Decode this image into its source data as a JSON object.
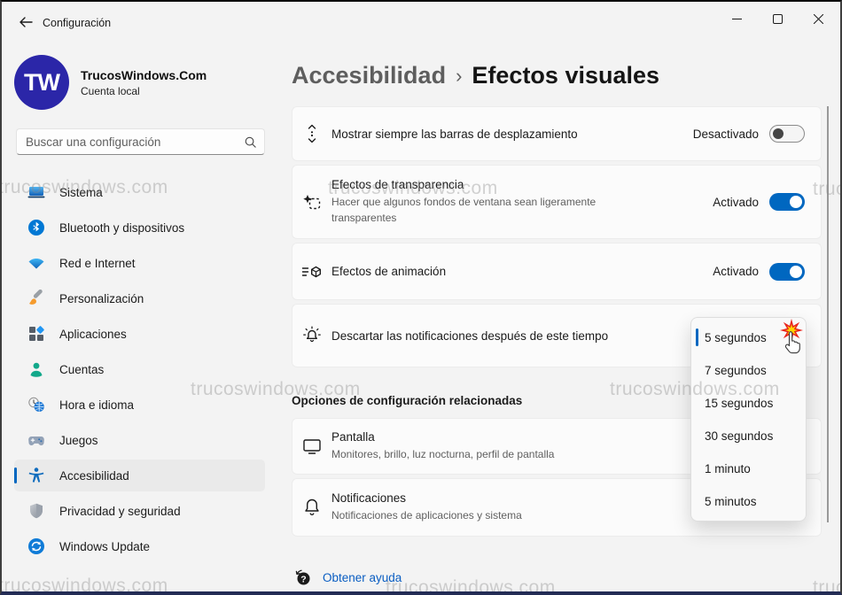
{
  "titlebar": {
    "title": "Configuración"
  },
  "watermark": "trucoswindows.com",
  "profile": {
    "initials": "TW",
    "name": "TrucosWindows.Com",
    "account_type": "Cuenta local"
  },
  "search": {
    "placeholder": "Buscar una configuración"
  },
  "sidebar": {
    "items": [
      {
        "label": "Sistema"
      },
      {
        "label": "Bluetooth y dispositivos"
      },
      {
        "label": "Red e Internet"
      },
      {
        "label": "Personalización"
      },
      {
        "label": "Aplicaciones"
      },
      {
        "label": "Cuentas"
      },
      {
        "label": "Hora e idioma"
      },
      {
        "label": "Juegos"
      },
      {
        "label": "Accesibilidad",
        "selected": true
      },
      {
        "label": "Privacidad y seguridad"
      },
      {
        "label": "Windows Update"
      }
    ]
  },
  "header": {
    "breadcrumb": "Accesibilidad",
    "separator": "›",
    "title": "Efectos visuales"
  },
  "settings": [
    {
      "title": "Mostrar siempre las barras de desplazamiento",
      "state_label": "Desactivado",
      "state": "off"
    },
    {
      "title": "Efectos de transparencia",
      "subtitle": "Hacer que algunos fondos de ventana sean ligeramente transparentes",
      "state_label": "Activado",
      "state": "on"
    },
    {
      "title": "Efectos de animación",
      "state_label": "Activado",
      "state": "on"
    },
    {
      "title": "Descartar las notificaciones después de este tiempo",
      "control": "dropdown",
      "value": "5 segundos"
    }
  ],
  "dropdown": {
    "selected": "5 segundos",
    "options": [
      "5 segundos",
      "7 segundos",
      "15 segundos",
      "30 segundos",
      "1 minuto",
      "5 minutos"
    ]
  },
  "related": {
    "heading": "Opciones de configuración relacionadas",
    "items": [
      {
        "title": "Pantalla",
        "subtitle": "Monitores, brillo, luz nocturna, perfil de pantalla"
      },
      {
        "title": "Notificaciones",
        "subtitle": "Notificaciones de aplicaciones y sistema"
      }
    ]
  },
  "footer": {
    "help_label": "Obtener ayuda"
  },
  "colors": {
    "accent": "#0067c0",
    "avatar": "#2b26a8",
    "link": "#0a5dc2"
  }
}
